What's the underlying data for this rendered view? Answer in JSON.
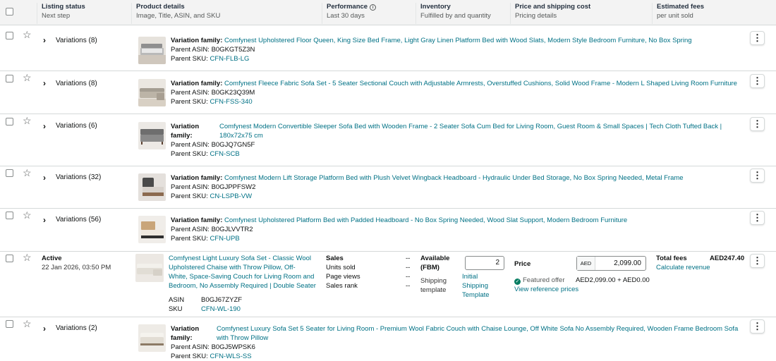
{
  "header": {
    "status_title": "Listing status",
    "status_sub": "Next step",
    "details_title": "Product details",
    "details_sub": "Image, Title, ASIN, and SKU",
    "perf_title": "Performance",
    "perf_sub": "Last 30 days",
    "inv_title": "Inventory",
    "inv_sub": "Fulfilled by and quantity",
    "price_title": "Price and shipping cost",
    "price_sub": "Pricing details",
    "fees_title": "Estimated fees",
    "fees_sub": "per unit sold"
  },
  "labels": {
    "family": "Variation family:",
    "family_word": "Variation",
    "family_word2": "family:",
    "parent_asin": "Parent ASIN:",
    "parent_sku": "Parent SKU:",
    "kebab": "⋮"
  },
  "rows": [
    {
      "variations": "Variations (8)",
      "title": "Comfynest Upholstered Floor Queen, King Size Bed Frame, Light Gray Linen Platform Bed with Wood Slats, Modern Style Bedroom Furniture, No Box Spring",
      "asin": "B0GKGT5Z3N",
      "sku": "CFN-FLB-LG"
    },
    {
      "variations": "Variations (8)",
      "title": "Comfynest Fleece Fabric Sofa Set - 5 Seater Sectional Couch with Adjustable Armrests, Overstuffed Cushions, Solid Wood Frame - Modern L Shaped Living Room Furniture",
      "asin": "B0GK23Q39M",
      "sku": "CFN-FSS-340"
    },
    {
      "variations": "Variations (6)",
      "title_line1": "Comfynest Modern Convertible Sleeper Sofa Bed with Wooden Frame - 2 Seater Sofa Cum Bed for Living Room, Guest Room & Small Spaces | Tech Cloth Tufted Back |",
      "title_line2": "180x72x75 cm",
      "asin": "B0GJQ7GN5F",
      "sku": "CFN-SCB"
    },
    {
      "variations": "Variations (32)",
      "title": "Comfynest Modern Lift Storage Platform Bed with Plush Velvet Wingback Headboard - Hydraulic Under Bed Storage, No Box Spring Needed, Metal Frame",
      "asin": "B0GJPPFSW2",
      "sku": "CN-LSPB-VW"
    },
    {
      "variations": "Variations (56)",
      "title": "Comfynest Upholstered Platform Bed with Padded Headboard - No Box Spring Needed, Wood Slat Support, Modern Bedroom Furniture",
      "asin": "B0GJLVVTR2",
      "sku": "CFN-UPB"
    },
    {
      "variations": "Variations (2)",
      "title_line1": "Comfynest Luxury Sofa Set 5 Seater for Living Room - Premium Wool Fabric Couch with Chaise Lounge, Off White Sofa No Assembly Required, Wooden Frame Bedroom Sofa",
      "title_line2": "with Throw Pillow",
      "asin": "B0GJ5WPSK6",
      "sku": "CFN-WLS-SS"
    }
  ],
  "active": {
    "status": "Active",
    "date": "22 Jan 2026, 03:50 PM",
    "title_lines": [
      "Comfynest Light Luxury Sofa Set - Classic Wool",
      "Upholstered Chaise with Throw Pillow, Off-",
      "White, Space-Saving Couch for Living Room and",
      "Bedroom, No Assembly Required | Double Seater"
    ],
    "asin_label": "ASIN",
    "asin": "B0GJ67ZYZF",
    "sku_label": "SKU",
    "sku": "CFN-WL-190",
    "perf": [
      {
        "label": "Sales",
        "value": "--"
      },
      {
        "label": "Units sold",
        "value": "--"
      },
      {
        "label": "Page views",
        "value": "--"
      },
      {
        "label": "Sales rank",
        "value": "--"
      }
    ],
    "available_l1": "Available",
    "available_l2": "(FBM)",
    "quantity": "2",
    "ship_l1": "Shipping",
    "ship_l2": "template",
    "ship_link_l1": "Initial",
    "ship_link_l2": "Shipping",
    "ship_link_l3": "Template",
    "price_label": "Price",
    "currency": "AED",
    "price": "2,099.00",
    "featured": "Featured offer",
    "featured_price": "AED2,099.00 + AED0.00",
    "ref_prices": "View reference prices",
    "fees_label": "Total fees",
    "fees_value": "AED247.40",
    "calc": "Calculate revenue"
  },
  "colors": {
    "link": "#007185",
    "header_bg": "#f3f3f3",
    "ok": "#067d62"
  }
}
